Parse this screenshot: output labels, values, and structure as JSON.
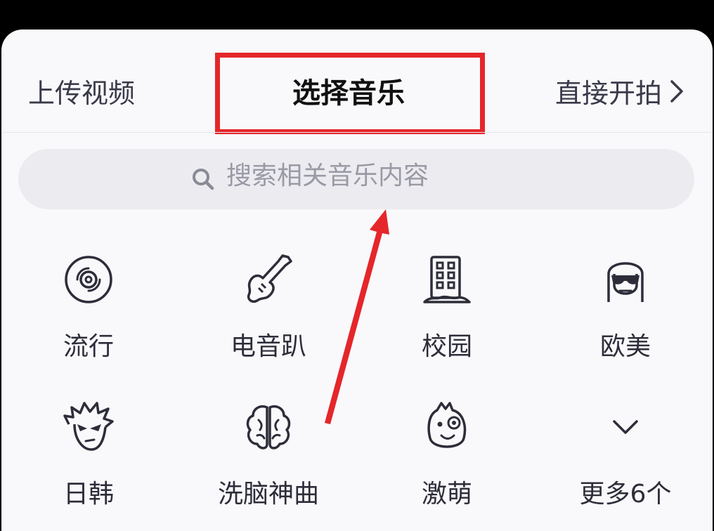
{
  "tabs": {
    "upload_video": "上传视频",
    "select_music": "选择音乐",
    "shoot_directly": "直接开拍",
    "chevron": "›"
  },
  "search": {
    "placeholder": "搜索相关音乐内容"
  },
  "categories": [
    {
      "label": "流行",
      "icon": "vinyl-disc-icon"
    },
    {
      "label": "电音趴",
      "icon": "electric-guitar-icon"
    },
    {
      "label": "校园",
      "icon": "school-building-icon"
    },
    {
      "label": "欧美",
      "icon": "sunglasses-woman-icon"
    },
    {
      "label": "日韩",
      "icon": "anime-boy-icon"
    },
    {
      "label": "洗脑神曲",
      "icon": "brain-icon"
    },
    {
      "label": "激萌",
      "icon": "cute-creature-icon"
    },
    {
      "label": "更多6个",
      "icon": "chevron-down-icon"
    }
  ],
  "colors": {
    "highlight": "#e5262a",
    "arrow": "#e5262a",
    "background": "#f9f9fb",
    "search_bg": "#ececf0"
  }
}
